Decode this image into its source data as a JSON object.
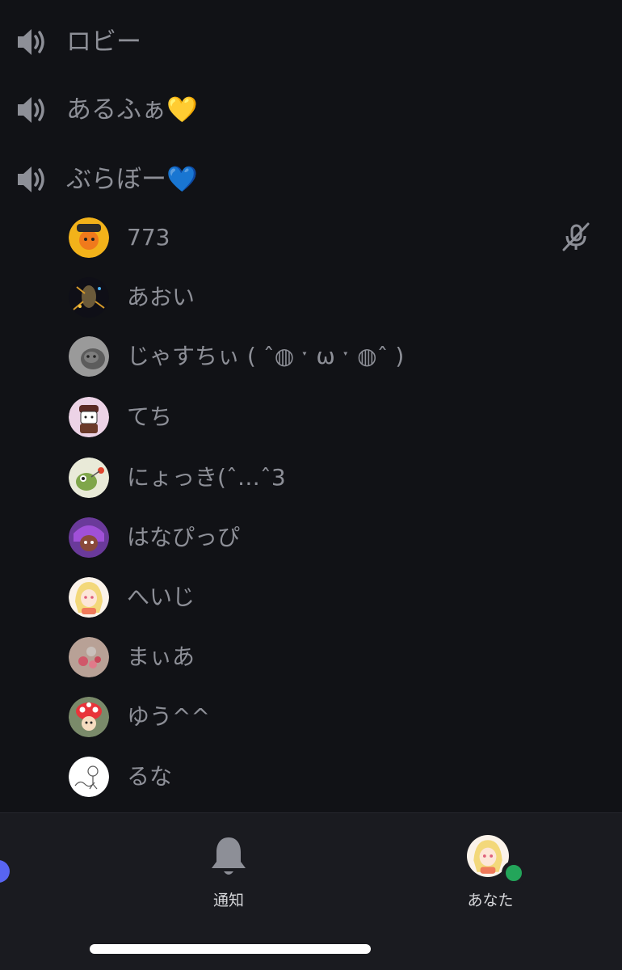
{
  "channels": [
    {
      "name": "ロビー",
      "icon": "speaker-icon"
    },
    {
      "name": "あるふぁ💛",
      "icon": "speaker-icon"
    },
    {
      "name": "ぶらぼー💙",
      "icon": "speaker-icon"
    }
  ],
  "members": [
    {
      "name": "773",
      "muted": true
    },
    {
      "name": "あおい"
    },
    {
      "name": "じゃすちぃ ( ˆ◍ ˑ ω ˑ ◍ˆ )"
    },
    {
      "name": "てち"
    },
    {
      "name": "にょっき(ˆ…ˆ3"
    },
    {
      "name": "はなぴっぴ"
    },
    {
      "name": "へいじ"
    },
    {
      "name": "まぃあ"
    },
    {
      "name": "ゆう^^"
    },
    {
      "name": "るな"
    }
  ],
  "tabs": {
    "notifications": {
      "label": "通知",
      "icon": "bell-icon"
    },
    "you": {
      "label": "あなた",
      "status_color": "#23a55a"
    }
  },
  "colors": {
    "background": "#111216",
    "bottom_bar": "#1a1b20",
    "text_muted": "#8d8f97",
    "accent": "#5865f2"
  }
}
